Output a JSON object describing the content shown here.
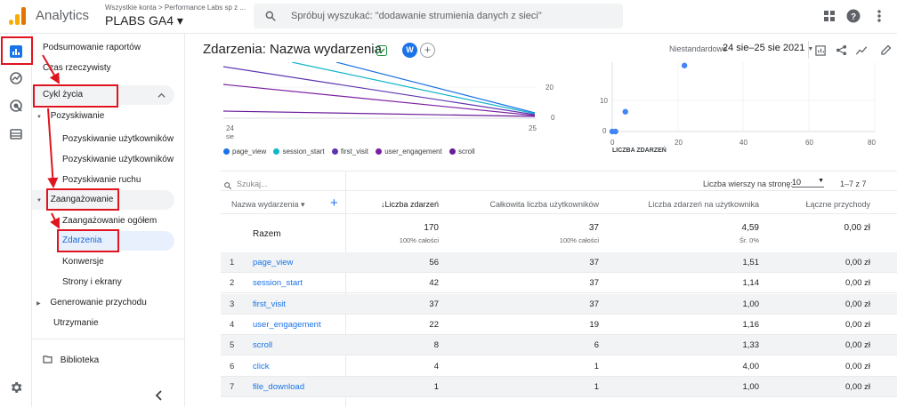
{
  "app": {
    "name": "Analytics",
    "breadcrumb": "Wszystkie konta > Performance Labs sp z ...",
    "property": "PLABS GA4 ▾"
  },
  "search": {
    "placeholder": "Spróbuj wyszukać: \"dodawanie strumienia danych z sieci\""
  },
  "topbar_icons": [
    "apps-icon",
    "help-icon",
    "more-vert-icon"
  ],
  "rail": [
    "reports-icon",
    "explore-icon",
    "advertising-icon",
    "configure-icon",
    "settings-icon"
  ],
  "nav": {
    "items": [
      {
        "label": "Podsumowanie raportów"
      },
      {
        "label": "Czas rzeczywisty"
      },
      {
        "label": "Cykl życia"
      },
      {
        "label": "Pozyskiwanie"
      },
      {
        "label": "Pozyskiwanie użytkowników"
      },
      {
        "label": "Pozyskiwanie użytkowników"
      },
      {
        "label": "Pozyskiwanie ruchu"
      },
      {
        "label": "Zaangażowanie"
      },
      {
        "label": "Zaangażowanie ogółem"
      },
      {
        "label": "Zdarzenia"
      },
      {
        "label": "Konwersje"
      },
      {
        "label": "Strony i ekrany"
      },
      {
        "label": "Generowanie przychodu"
      },
      {
        "label": "Utrzymanie"
      },
      {
        "label": "Biblioteka"
      }
    ]
  },
  "header": {
    "title": "Zdarzenia: Nazwa wydarzenia",
    "avatar": "W",
    "date_label": "Niestandardowe",
    "date_range": "24 sie–25 sie 2021"
  },
  "line_chart": {
    "ticks_y": [
      "20",
      "0"
    ],
    "ticks_x": [
      "24",
      "sie",
      "25"
    ],
    "legend": [
      {
        "name": "page_view",
        "color": "#1a73e8"
      },
      {
        "name": "session_start",
        "color": "#12b5cb"
      },
      {
        "name": "first_visit",
        "color": "#5e35b1"
      },
      {
        "name": "user_engagement",
        "color": "#7b1fa2"
      },
      {
        "name": "scroll",
        "color": "#6a1b9a"
      }
    ]
  },
  "scatter": {
    "ticks_y": [
      "10",
      "0"
    ],
    "ticks_x": [
      "0",
      "20",
      "40",
      "60",
      "80"
    ],
    "xlabel": "LICZBA ZDARZEŃ",
    "points": [
      [
        0,
        0
      ],
      [
        1,
        0
      ],
      [
        4,
        6
      ],
      [
        22,
        20
      ]
    ]
  },
  "table": {
    "search_placeholder": "Szukaj...",
    "rows_label": "Liczba wierszy na stronę:",
    "rows_value": "10",
    "pagination": "1–7 z 7",
    "headers": [
      "Nazwa wydarzenia ▾",
      "↓Liczba zdarzeń",
      "Całkowita liczba użytkowników",
      "Liczba zdarzeń na użytkownika",
      "Łączne przychody"
    ],
    "total": {
      "label": "Razem",
      "events": "170",
      "events_sub": "100% całości",
      "users": "37",
      "users_sub": "100% całości",
      "per_user": "4,59",
      "per_user_sub": "Śr. 0%",
      "revenue": "0,00 zł"
    },
    "rows": [
      {
        "n": "1",
        "name": "page_view",
        "events": "56",
        "users": "37",
        "per_user": "1,51",
        "revenue": "0,00 zł"
      },
      {
        "n": "2",
        "name": "session_start",
        "events": "42",
        "users": "37",
        "per_user": "1,14",
        "revenue": "0,00 zł"
      },
      {
        "n": "3",
        "name": "first_visit",
        "events": "37",
        "users": "37",
        "per_user": "1,00",
        "revenue": "0,00 zł"
      },
      {
        "n": "4",
        "name": "user_engagement",
        "events": "22",
        "users": "19",
        "per_user": "1,16",
        "revenue": "0,00 zł"
      },
      {
        "n": "5",
        "name": "scroll",
        "events": "8",
        "users": "6",
        "per_user": "1,33",
        "revenue": "0,00 zł"
      },
      {
        "n": "6",
        "name": "click",
        "events": "4",
        "users": "1",
        "per_user": "4,00",
        "revenue": "0,00 zł"
      },
      {
        "n": "7",
        "name": "file_download",
        "events": "1",
        "users": "1",
        "per_user": "1,00",
        "revenue": "0,00 zł"
      }
    ]
  }
}
